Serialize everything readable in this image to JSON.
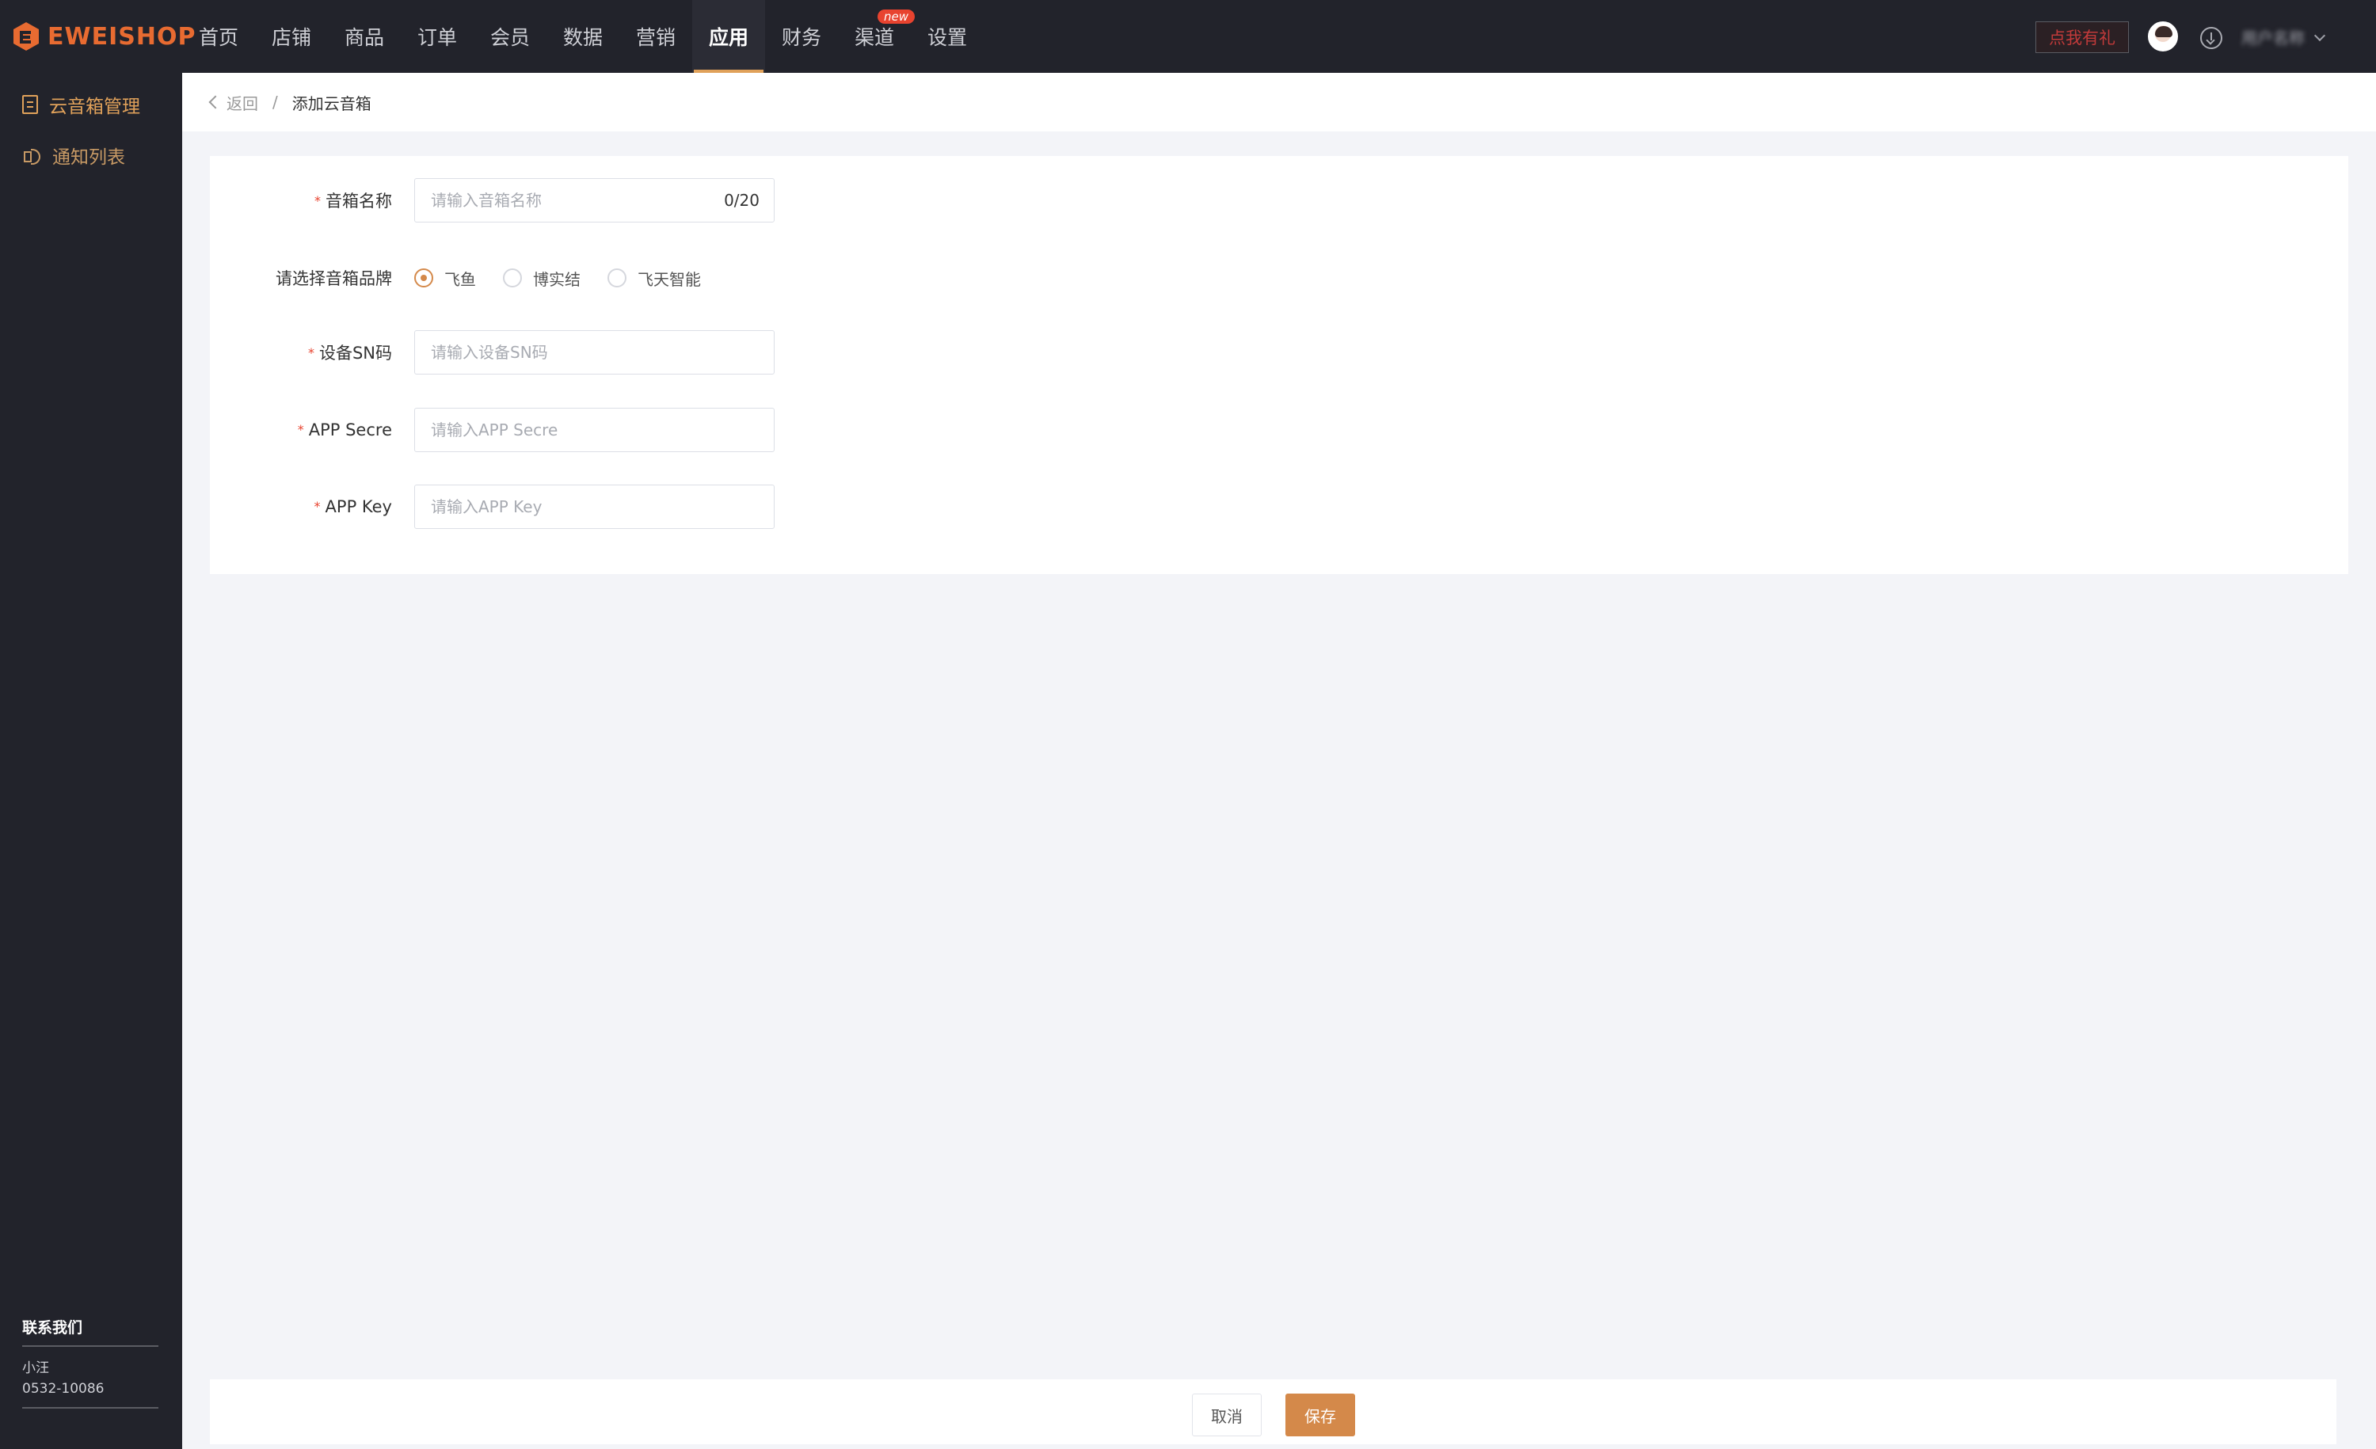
{
  "app": {
    "logo_text": "EWEISHOP",
    "brand_color": "#e86b31",
    "accent_color": "#d4894a"
  },
  "nav": {
    "items": [
      {
        "label": "首页",
        "active": false
      },
      {
        "label": "店铺",
        "active": false
      },
      {
        "label": "商品",
        "active": false
      },
      {
        "label": "订单",
        "active": false
      },
      {
        "label": "会员",
        "active": false
      },
      {
        "label": "数据",
        "active": false
      },
      {
        "label": "营销",
        "active": false
      },
      {
        "label": "应用",
        "active": true
      },
      {
        "label": "财务",
        "active": false
      },
      {
        "label": "渠道",
        "active": false,
        "badge": "new"
      },
      {
        "label": "设置",
        "active": false
      }
    ],
    "gift_button": "点我有礼",
    "user_name": "用户名称"
  },
  "sidebar": {
    "items": [
      {
        "label": "云音箱管理",
        "icon": "document-icon",
        "active": true
      },
      {
        "label": "通知列表",
        "icon": "speaker-icon",
        "active": false
      }
    ],
    "contact": {
      "title": "联系我们",
      "name": "小汪",
      "phone": "0532-10086"
    }
  },
  "breadcrumb": {
    "back": "返回",
    "separator": "/",
    "current": "添加云音箱"
  },
  "form": {
    "name": {
      "label": "音箱名称",
      "placeholder": "请输入音箱名称",
      "value": "",
      "counter": "0/20",
      "required": true
    },
    "brand": {
      "label": "请选择音箱品牌",
      "options": [
        "飞鱼",
        "博实结",
        "飞天智能"
      ],
      "selected": "飞鱼"
    },
    "sn": {
      "label": "设备SN码",
      "placeholder": "请输入设备SN码",
      "value": "",
      "required": true
    },
    "app_secre": {
      "label": "APP Secre",
      "placeholder": "请输入APP Secre",
      "value": "",
      "required": true
    },
    "app_key": {
      "label": "APP Key",
      "placeholder": "请输入APP Key",
      "value": "",
      "required": true
    }
  },
  "footer": {
    "cancel_label": "取消",
    "save_label": "保存"
  }
}
